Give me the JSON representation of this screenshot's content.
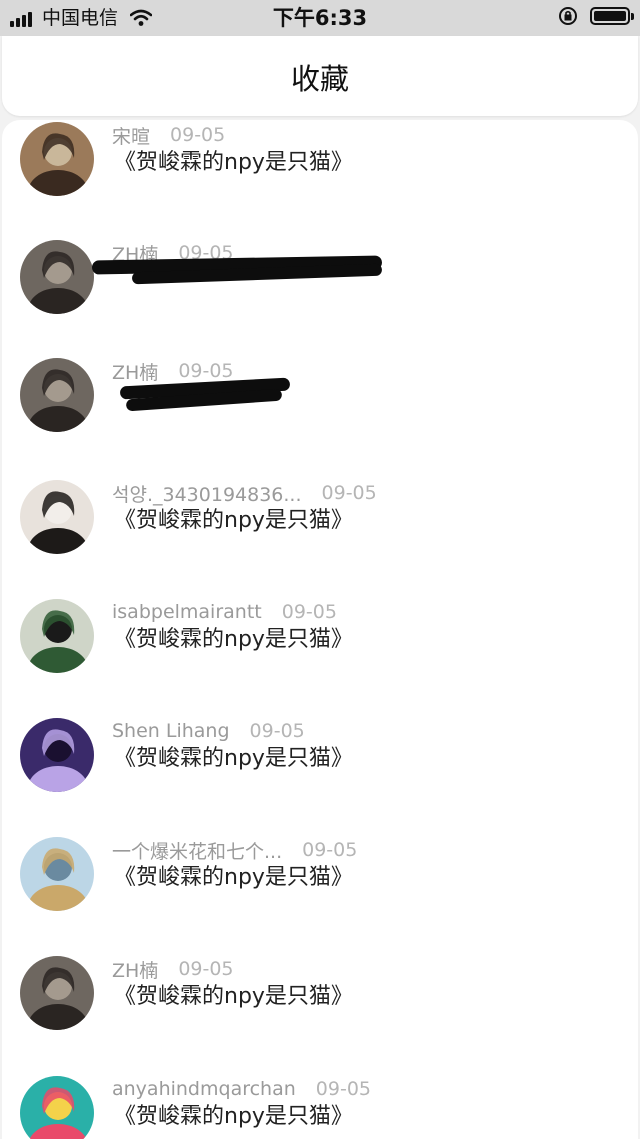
{
  "status_bar": {
    "carrier": "中国电信",
    "time": "下午6:33"
  },
  "header": {
    "title": "收藏"
  },
  "favorites": [
    {
      "username": "宋暄",
      "date": "09-05",
      "content": "《贺峻霖的npy是只猫》",
      "avatar_colors": [
        "#9b7a5a",
        "#3a2a20",
        "#c9b79a"
      ]
    },
    {
      "username": "ZH楠",
      "date": "09-05",
      "content": "",
      "redacted": true,
      "avatar_colors": [
        "#6e6760",
        "#2a2522",
        "#a49a8e"
      ]
    },
    {
      "username": "ZH楠",
      "date": "09-05",
      "content": "",
      "redacted": true,
      "avatar_colors": [
        "#6e6760",
        "#2a2522",
        "#a49a8e"
      ]
    },
    {
      "username": "석양._3430194836...",
      "date": "09-05",
      "content": "《贺峻霖的npy是只猫》",
      "avatar_colors": [
        "#e8e2dc",
        "#1d1a18",
        "#f2eeea"
      ]
    },
    {
      "username": "isabpelmairantt",
      "date": "09-05",
      "content": "《贺峻霖的npy是只猫》",
      "avatar_colors": [
        "#cfd5c8",
        "#2f5a34",
        "#1a1a1a"
      ]
    },
    {
      "username": "Shen Lihang",
      "date": "09-05",
      "content": "《贺峻霖的npy是只猫》",
      "avatar_colors": [
        "#3a2a6a",
        "#b9a3e6",
        "#1a1030"
      ]
    },
    {
      "username": "一个爆米花和七个...",
      "date": "09-05",
      "content": "《贺峻霖的npy是只猫》",
      "avatar_colors": [
        "#bcd6e6",
        "#caa86a",
        "#6a8aa0"
      ]
    },
    {
      "username": "ZH楠",
      "date": "09-05",
      "content": "《贺峻霖的npy是只猫》",
      "avatar_colors": [
        "#6e6760",
        "#2a2522",
        "#a49a8e"
      ]
    },
    {
      "username": "anyahindmqarchan",
      "date": "09-05",
      "content": "《贺峻霖的npy是只猫》",
      "avatar_colors": [
        "#2ab0a8",
        "#e94a6a",
        "#f4d24a"
      ]
    }
  ]
}
